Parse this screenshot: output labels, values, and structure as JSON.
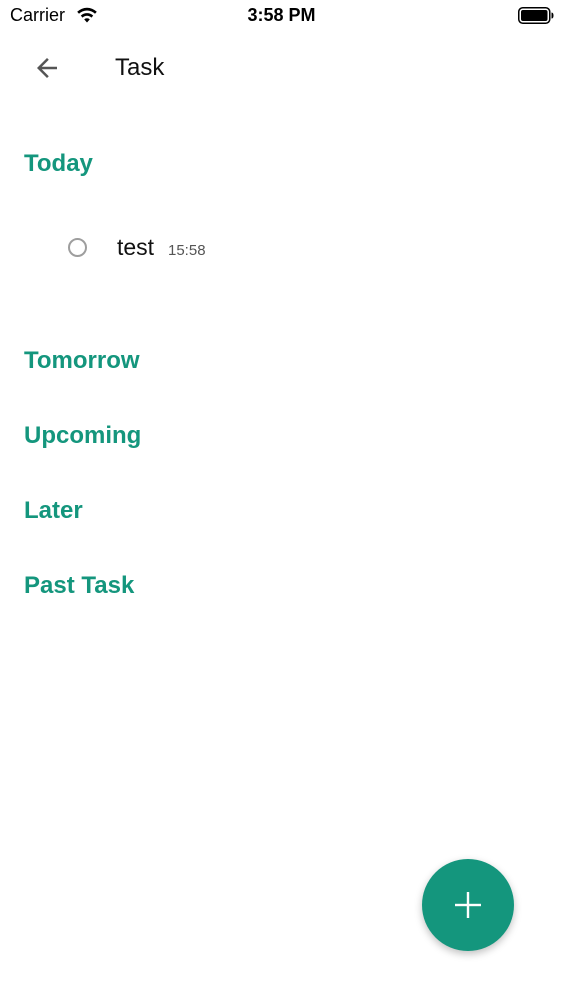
{
  "status_bar": {
    "carrier": "Carrier",
    "time": "3:58 PM",
    "wifi_icon": "wifi-icon",
    "battery_icon": "battery-icon"
  },
  "app_bar": {
    "back_icon": "arrow-left-icon",
    "title": "Task"
  },
  "sections": {
    "today": "Today",
    "tomorrow": "Tomorrow",
    "upcoming": "Upcoming",
    "later": "Later",
    "past": "Past Task"
  },
  "tasks": {
    "today": [
      {
        "title": "test",
        "time": "15:58",
        "done": false
      }
    ]
  },
  "fab": {
    "icon": "plus-icon"
  },
  "colors": {
    "accent": "#14967d",
    "checkbox_border": "#9e9e9e"
  }
}
